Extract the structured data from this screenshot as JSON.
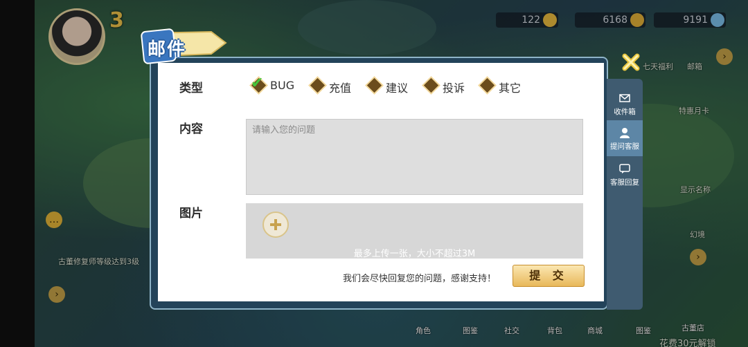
{
  "hud": {
    "level": "3",
    "resources": [
      "122",
      "6168",
      "9191"
    ],
    "left_items": [
      "古董修复师等级达到3级"
    ],
    "right_items": [
      "七天福利",
      "邮箱",
      "特惠月卡",
      "显示名称",
      "幻境"
    ],
    "bottom_items": [
      "角色",
      "图鉴",
      "社交",
      "背包",
      "商城",
      "图鉴",
      "古董店"
    ],
    "promo": "花费30元解锁"
  },
  "dialog": {
    "title": "邮件",
    "side_tabs": [
      {
        "label": "收件箱",
        "icon": "envelope-icon",
        "active": false
      },
      {
        "label": "提问客服",
        "icon": "person-icon",
        "active": true
      },
      {
        "label": "客服回复",
        "icon": "chat-icon",
        "active": false
      }
    ],
    "type_label": "类型",
    "types": [
      {
        "label": "BUG",
        "checked": true
      },
      {
        "label": "充值",
        "checked": false
      },
      {
        "label": "建议",
        "checked": false
      },
      {
        "label": "投诉",
        "checked": false
      },
      {
        "label": "其它",
        "checked": false
      }
    ],
    "content_label": "内容",
    "content_placeholder": "请输入您的问题",
    "image_label": "图片",
    "image_hint": "最多上传一张，大小不超过3M",
    "footer_note": "我们会尽快回复您的问题，感谢支持！",
    "submit_label": "提 交"
  },
  "colors": {
    "dialog_frame": "#23435a",
    "side_tab_active": "#5d86a6",
    "checkbox_check": "#46c43a",
    "submit_button": "#e8b85a"
  }
}
